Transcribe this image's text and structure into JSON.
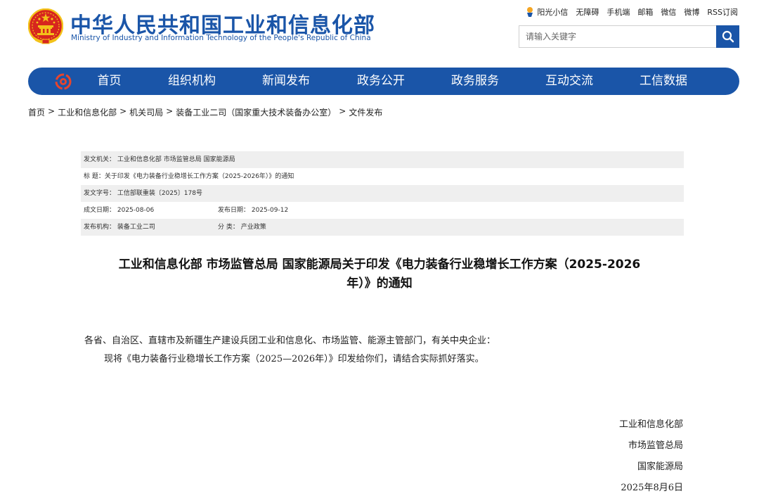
{
  "header": {
    "brand_cn": "中华人民共和国工业和信息化部",
    "brand_en": "Ministry of Industry and Information Technology of the People's Republic of China",
    "top_links": [
      "阳光小信",
      "无障碍",
      "手机端",
      "邮箱",
      "微信",
      "微博",
      "RSS订阅"
    ],
    "search": {
      "placeholder": "请输入关键字"
    }
  },
  "nav": {
    "items": [
      "首页",
      "组织机构",
      "新闻发布",
      "政务公开",
      "政务服务",
      "互动交流",
      "工信数据"
    ]
  },
  "breadcrumb": [
    "首页",
    "工业和信息化部",
    "机关司局",
    "装备工业二司（国家重大技术装备办公室）",
    "文件发布"
  ],
  "breadcrumb_sep": ">",
  "meta": {
    "issuer": "发文机关：  工业和信息化部 市场监管总局 国家能源局",
    "title": "标      题：关于印发《电力装备行业稳增长工作方案（2025-2026年）》的通知",
    "doc_no": "发文字号：  工信部联重装〔2025〕178号",
    "date_written": "成文日期：  2025-08-06",
    "date_published": "发布日期：  2025-09-12",
    "issuing_dept": "发布机构：  装备工业二司",
    "category": "分      类：  产业政策"
  },
  "doc": {
    "title_line1": "工业和信息化部 市场监管总局 国家能源局关于印发《电力装备行业稳增长工作方案（2025-2026",
    "title_line2": "年）》的通知",
    "para1": "各省、自治区、直辖市及新疆生产建设兵团工业和信息化、市场监管、能源主管部门，有关中央企业：",
    "para2": "现将《电力装备行业稳增长工作方案（2025—2026年）》印发给你们，请结合实际抓好落实。",
    "signers": [
      "工业和信息化部",
      "市场监管总局",
      "国家能源局"
    ],
    "sign_date": "2025年8月6日"
  },
  "colors": {
    "brand_blue": "#1a55a8",
    "emblem_red": "#d7261e",
    "emblem_gold": "#f3c21a",
    "row_shade": "#efefef"
  },
  "icons": {
    "emblem": "national-emblem-icon",
    "search": "search-icon",
    "sun": "sun-icon",
    "nav_logo": "miit-logo-icon"
  }
}
